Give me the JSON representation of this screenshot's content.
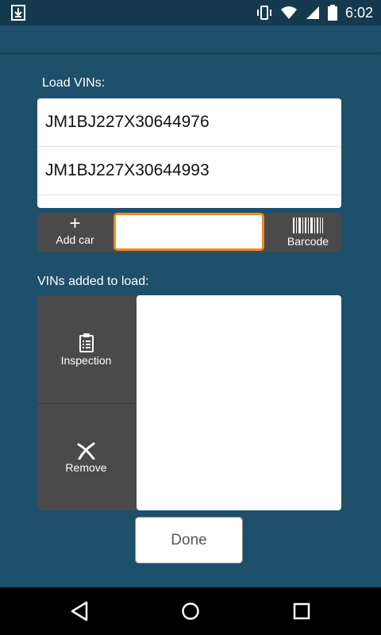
{
  "status_bar": {
    "time": "6:02",
    "icons": [
      "download-icon",
      "vibrate-icon",
      "wifi-icon",
      "signal-icon",
      "battery-icon"
    ]
  },
  "load_section": {
    "label": "Load VINs:",
    "vins": [
      "JM1BJ227X30644976",
      "JM1BJ227X30644993"
    ]
  },
  "action_bar": {
    "add_car_label": "Add car",
    "add_car_icon": "+",
    "input_value": "",
    "barcode_label": "Barcode"
  },
  "added_section": {
    "label": "VINs added to load:",
    "inspection_label": "Inspection",
    "remove_label": "Remove",
    "items": []
  },
  "done_label": "Done",
  "nav_bar": {
    "icons": [
      "back-icon",
      "home-icon",
      "recents-icon"
    ]
  },
  "colors": {
    "background": "#1e4f6b",
    "dark_panel": "#4a4a4a",
    "accent": "#f08a24"
  }
}
